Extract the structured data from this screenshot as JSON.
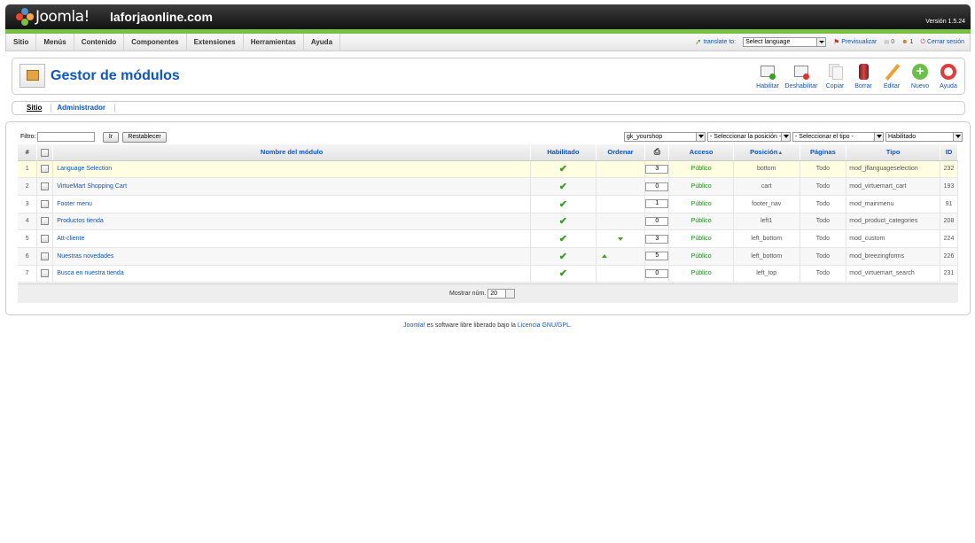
{
  "header": {
    "logo_text": "Joomla!",
    "site_name": "laforjaonline.com",
    "version": "Versión 1.5.24"
  },
  "menu": {
    "items": [
      "Sitio",
      "Menús",
      "Contenido",
      "Componentes",
      "Extensiones",
      "Herramientas",
      "Ayuda"
    ],
    "translate_label": "translate to:",
    "language_select": "Select language",
    "preview": "Previsualizar",
    "messages_count": "0",
    "users_count": "1",
    "logout": "Cerrar sesión"
  },
  "page": {
    "title": "Gestor de módulos"
  },
  "toolbar": [
    "Habilitar",
    "Deshabilitar",
    "Copiar",
    "Borrar",
    "Editar",
    "Nuevo",
    "Ayuda"
  ],
  "subnav": {
    "tabs": [
      "Sitio",
      "Administrador"
    ]
  },
  "filter": {
    "label": "Filtro:",
    "value": "",
    "go_button": "Ir",
    "reset_button": "Restablecer",
    "template_select": "gk_yourshop",
    "position_select": "- Seleccionar la posición -",
    "type_select": "- Seleccionar el tipo -",
    "state_select": "Habilitado"
  },
  "table": {
    "headers": {
      "num": "#",
      "name": "Nombre del módulo",
      "enabled": "Habilitado",
      "order": "Ordenar",
      "access": "Acceso",
      "position": "Posición",
      "pages": "Páginas",
      "type": "Tipo",
      "id": "ID"
    },
    "rows": [
      {
        "n": "1",
        "name": "Language Selection",
        "order": "3",
        "access": "Público",
        "position": "bottom",
        "pages": "Todo",
        "type": "mod_jflanguageselection",
        "id": "232"
      },
      {
        "n": "2",
        "name": "VirtueMart Shopping Cart",
        "order": "0",
        "access": "Público",
        "position": "cart",
        "pages": "Todo",
        "type": "mod_virtuemart_cart",
        "id": "193"
      },
      {
        "n": "3",
        "name": "Footer menu",
        "order": "1",
        "access": "Público",
        "position": "footer_nav",
        "pages": "Todo",
        "type": "mod_mainmenu",
        "id": "91"
      },
      {
        "n": "4",
        "name": "Productos tienda",
        "order": "0",
        "access": "Público",
        "position": "left1",
        "pages": "Todo",
        "type": "mod_product_categories",
        "id": "208"
      },
      {
        "n": "5",
        "name": "Att-cliente",
        "order": "3",
        "access": "Público",
        "position": "left_bottom",
        "pages": "Todo",
        "type": "mod_custom",
        "id": "224"
      },
      {
        "n": "6",
        "name": "Nuestras novedades",
        "order": "5",
        "access": "Público",
        "position": "left_bottom",
        "pages": "Todo",
        "type": "mod_breezingforms",
        "id": "226"
      },
      {
        "n": "7",
        "name": "Busca en nuestra tienda",
        "order": "0",
        "access": "Público",
        "position": "left_top",
        "pages": "Todo",
        "type": "mod_virtuemart_search",
        "id": "231"
      }
    ]
  },
  "footer": {
    "show_label": "Mostrar núm.",
    "show_value": "20"
  },
  "credit": {
    "joomla": "Joomla!",
    "text": " es software libre liberado bajo la ",
    "license": "Licencia GNU/GPL",
    "end": "."
  }
}
